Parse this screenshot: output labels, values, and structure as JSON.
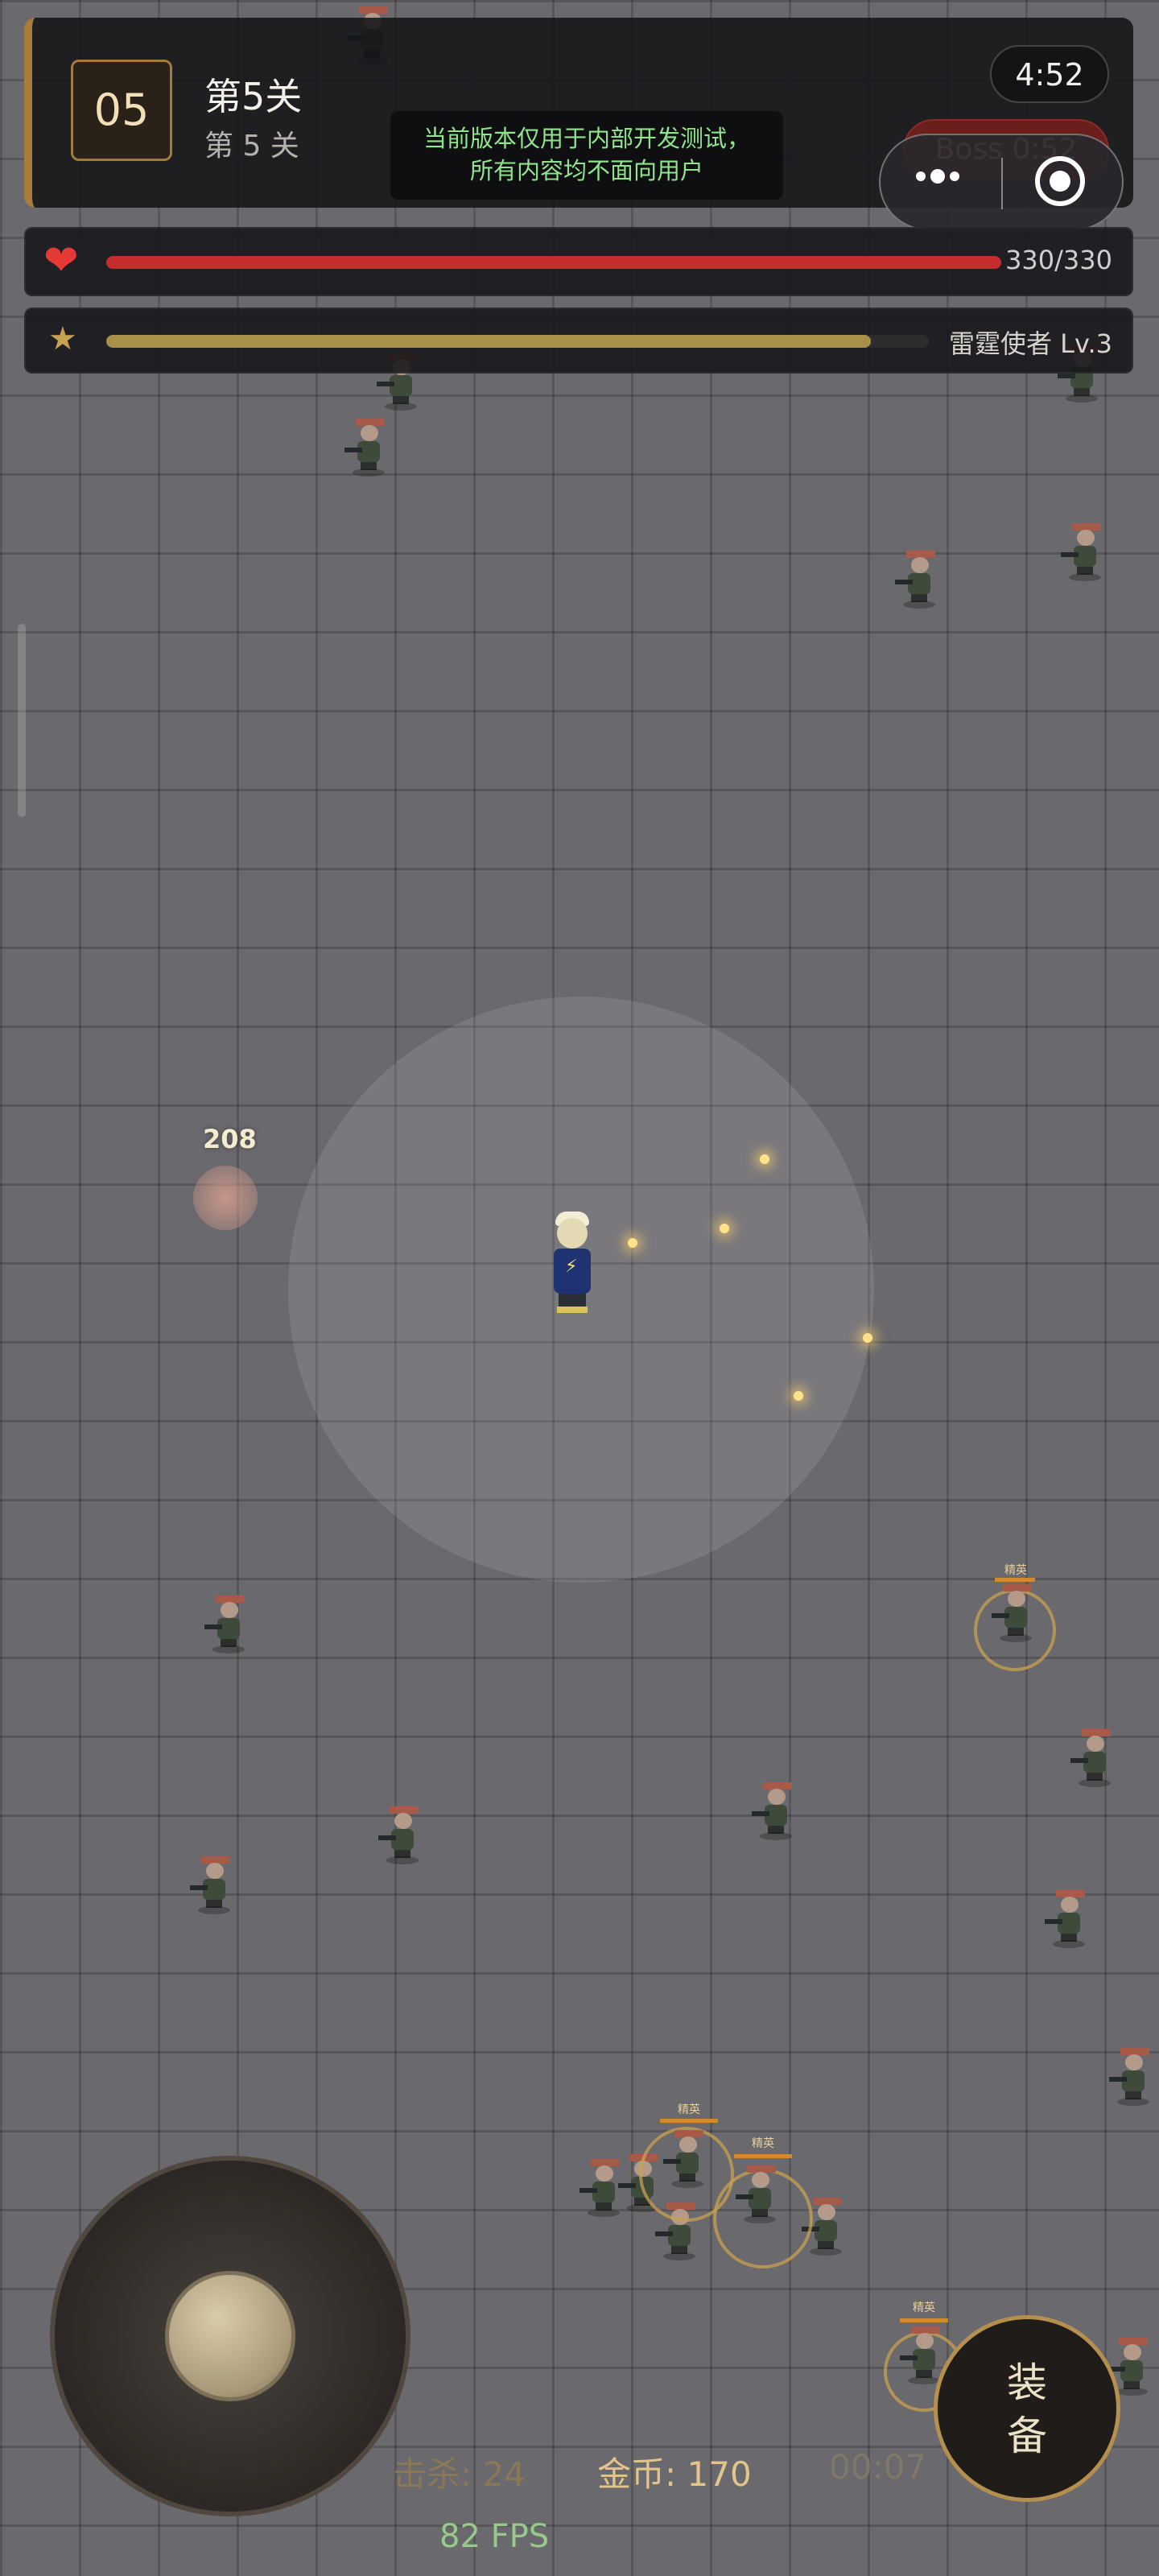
{
  "level": {
    "badge": "05",
    "title": "第5关",
    "subtitle": "第 5 关"
  },
  "notice": {
    "line1": "当前版本仅用于内部开发测试，",
    "line2": "所有内容均不面向用户"
  },
  "timers": {
    "countdown": "4:52",
    "boss": "Boss 0:52"
  },
  "hp": {
    "text": "330/330",
    "fraction": 1.0,
    "icon": "heart-icon",
    "color": "#c62e2e"
  },
  "xp": {
    "text": "雷霆使者 Lv.3",
    "fraction": 0.93,
    "icon": "star-icon",
    "color": "#a88f4a"
  },
  "combat": {
    "damage_number": "208"
  },
  "elite_label": "精英",
  "equip_button": {
    "line1": "装",
    "line2": "备"
  },
  "stats": {
    "kills": "击杀: 24",
    "gold": "金币: 170",
    "time": "00:07"
  },
  "fps": "82 FPS"
}
